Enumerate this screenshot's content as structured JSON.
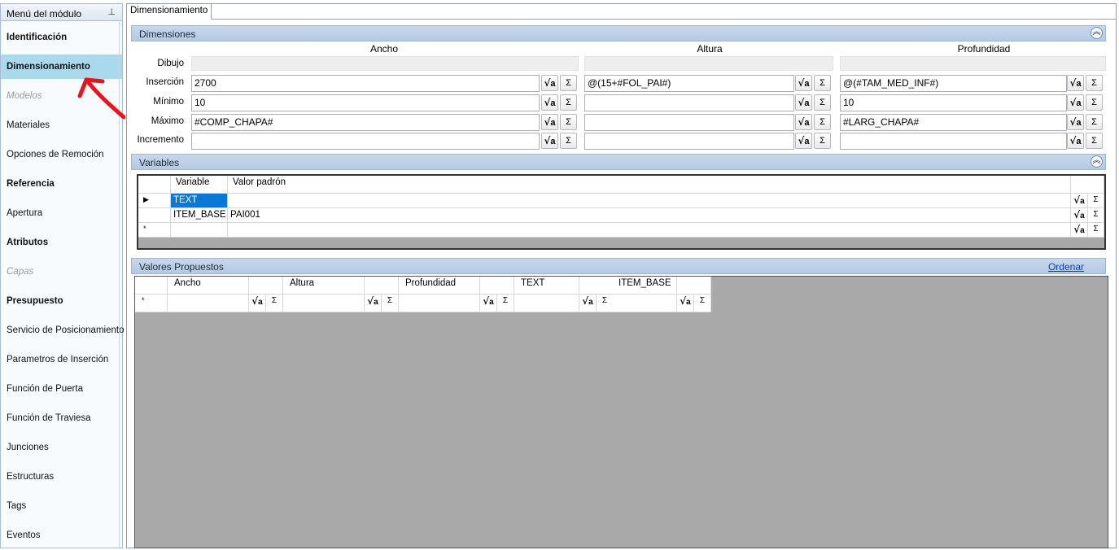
{
  "sidebar": {
    "title": "Menú del módulo",
    "pin_icon": "pin-icon",
    "items": [
      {
        "label": "Identificación",
        "style": "bold"
      },
      {
        "label": "Dimensionamiento",
        "style": "selected"
      },
      {
        "label": "Modelos",
        "style": "disabled"
      },
      {
        "label": "Materiales",
        "style": "normal"
      },
      {
        "label": "Opciones de Remoción",
        "style": "normal"
      },
      {
        "label": "Referencia",
        "style": "bold"
      },
      {
        "label": "Apertura",
        "style": "normal"
      },
      {
        "label": "Atributos",
        "style": "bold"
      },
      {
        "label": "Capas",
        "style": "disabled"
      },
      {
        "label": "Presupuesto",
        "style": "bold"
      },
      {
        "label": "Servicio de Posicionamiento",
        "style": "normal"
      },
      {
        "label": "Parametros de Inserción",
        "style": "normal"
      },
      {
        "label": "Función de Puerta",
        "style": "normal"
      },
      {
        "label": "Función de Traviesa",
        "style": "normal"
      },
      {
        "label": "Junciones",
        "style": "normal"
      },
      {
        "label": "Estructuras",
        "style": "normal"
      },
      {
        "label": "Tags",
        "style": "normal"
      },
      {
        "label": "Eventos",
        "style": "normal"
      }
    ]
  },
  "tab": {
    "label": "Dimensionamiento"
  },
  "dimensiones": {
    "title": "Dimensiones",
    "columns": [
      "Ancho",
      "Altura",
      "Profundidad"
    ],
    "row_labels": [
      "Dibujo",
      "Inserción",
      "Mínimo",
      "Máximo",
      "Incremento"
    ],
    "values": {
      "insercion": [
        "2700",
        "@(15+#FOL_PAI#)",
        "@(#TAM_MED_INF#)"
      ],
      "minimo": [
        "10",
        "",
        "10"
      ],
      "maximo": [
        "#COMP_CHAPA#",
        "",
        "#LARG_CHAPA#"
      ],
      "incremento": [
        "",
        "",
        ""
      ]
    },
    "formula_glyph": "√",
    "formula_badge": "a",
    "sum_glyph": "Σ"
  },
  "variables": {
    "title": "Variables",
    "headers": [
      "Variable",
      "Valor padrón"
    ],
    "rows": [
      {
        "variable": "TEXT",
        "valor": ""
      },
      {
        "variable": "ITEM_BASE",
        "valor": "PAI001"
      }
    ],
    "new_row_marker": "*",
    "current_row_marker": "▶"
  },
  "propuestos": {
    "title": "Valores Propuestos",
    "ordenar_label": "Ordenar",
    "headers": [
      "Ancho",
      "Altura",
      "Profundidad",
      "TEXT",
      "ITEM_BASE"
    ],
    "new_row_marker": "*"
  },
  "colors": {
    "selected_item": "#a9d9ec",
    "section_header": "#b3c9e3",
    "selection_blue": "#0a78d7",
    "annotation_arrow": "#e8141b",
    "link": "#0b3fb8"
  }
}
